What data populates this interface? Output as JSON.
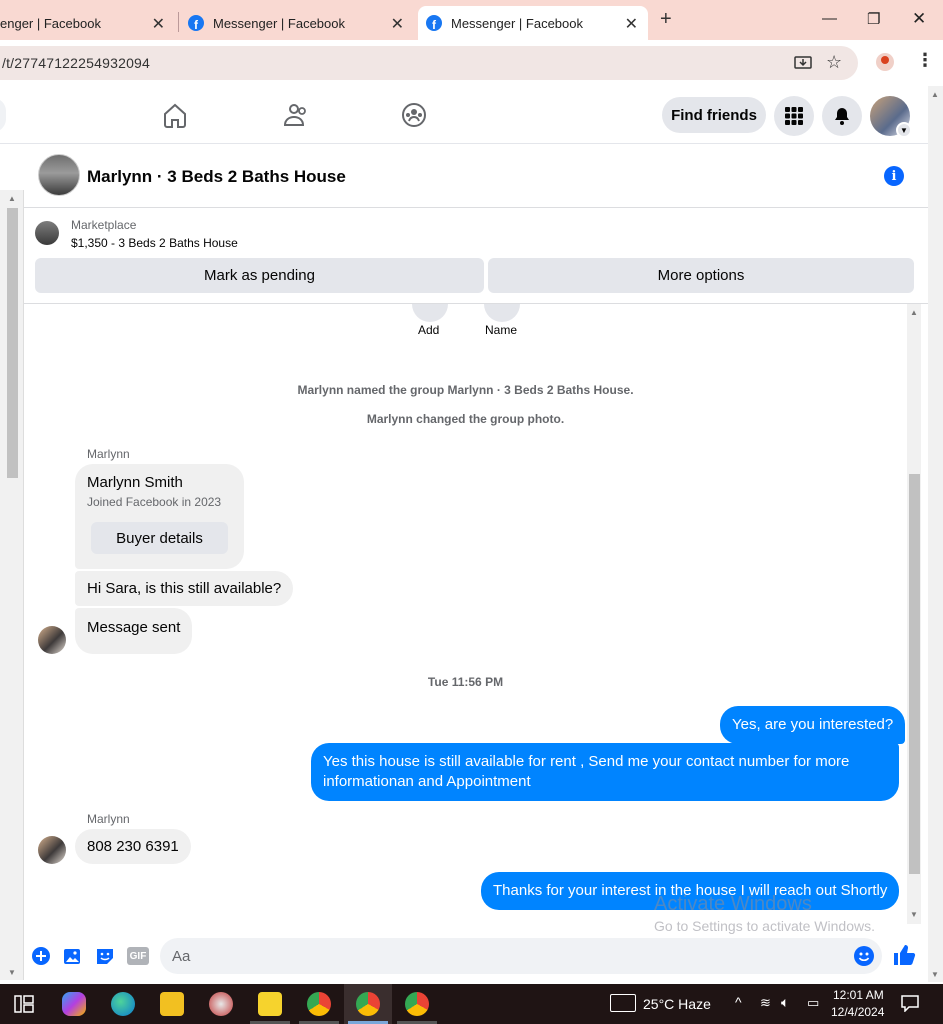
{
  "browser": {
    "tabs": [
      {
        "title": "enger | Facebook"
      },
      {
        "title": "Messenger | Facebook"
      },
      {
        "title": "Messenger | Facebook"
      }
    ],
    "url": "/t/27747122254932094"
  },
  "fbnav": {
    "find_friends": "Find friends"
  },
  "conversation": {
    "title": "Marlynn · 3 Beds 2 Baths House",
    "marketplace_label": "Marketplace",
    "listing": "$1,350 - 3 Beds 2 Baths House",
    "mark_pending": "Mark as pending",
    "more_options": "More options"
  },
  "chat": {
    "actions": [
      {
        "label": "Add"
      },
      {
        "label": "Name"
      }
    ],
    "system_messages": [
      "Marlynn named the group Marlynn · 3 Beds 2 Baths House.",
      "Marlynn changed the group photo."
    ],
    "sender_name": "Marlynn",
    "buyer_card": {
      "name": "Marlynn Smith",
      "joined": "Joined Facebook in 2023",
      "button": "Buyer details"
    },
    "incoming1": "Hi Sara, is this still available?",
    "incoming2": "Message sent",
    "timestamp": "Tue 11:56 PM",
    "outgoing1": "Yes, are you interested?",
    "outgoing2": "Yes this house is still available for rent , Send me your contact number for more informationan and Appointment",
    "incoming3": "808 230 6391",
    "outgoing3": "Thanks for your interest in the house I will reach out Shortly"
  },
  "composer": {
    "placeholder": "Aa",
    "gif_label": "GIF"
  },
  "watermark": {
    "line1": "Activate Windows",
    "line2": "Go to Settings to activate Windows."
  },
  "taskbar": {
    "weather": "25°C  Haze",
    "time": "12:01 AM",
    "date": "12/4/2024"
  },
  "colors": {
    "accent": "#0084ff",
    "tabbar": "#f9d9d2",
    "taskbar": "#1f1414"
  }
}
